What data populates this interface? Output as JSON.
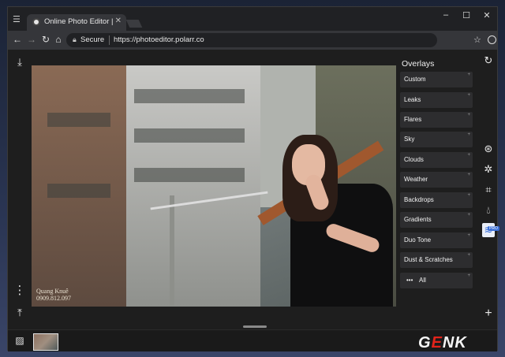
{
  "browser": {
    "tab_title": "Online Photo Editor | Pol",
    "secure_label": "Secure",
    "url": "https://photoeditor.polarr.co"
  },
  "editor": {
    "panel_title": "Overlays",
    "overlays": [
      "Custom",
      "Leaks",
      "Flares",
      "Sky",
      "Clouds",
      "Weather",
      "Backdrops",
      "Gradients",
      "Duo Tone",
      "Dust & Scratches",
      "All"
    ],
    "pro_badge": "PRO",
    "watermark_name": "Quang Knuê",
    "watermark_phone": "0909.812.097"
  },
  "brand": {
    "logo_text_g": "G",
    "logo_text_e": "E",
    "logo_text_nk": "NK",
    "accent_color": "#e2231a"
  },
  "icons": [
    "menu-icon",
    "close-icon",
    "minimize-icon",
    "maximize-icon",
    "back-icon",
    "forward-icon",
    "reload-icon",
    "home-icon",
    "lock-icon",
    "star-icon",
    "account-icon",
    "download-icon",
    "more-icon",
    "upload-icon",
    "history-icon",
    "filters-icon",
    "adjust-icon",
    "crop-icon",
    "retouch-icon",
    "layers-icon",
    "add-icon",
    "image-icon"
  ]
}
